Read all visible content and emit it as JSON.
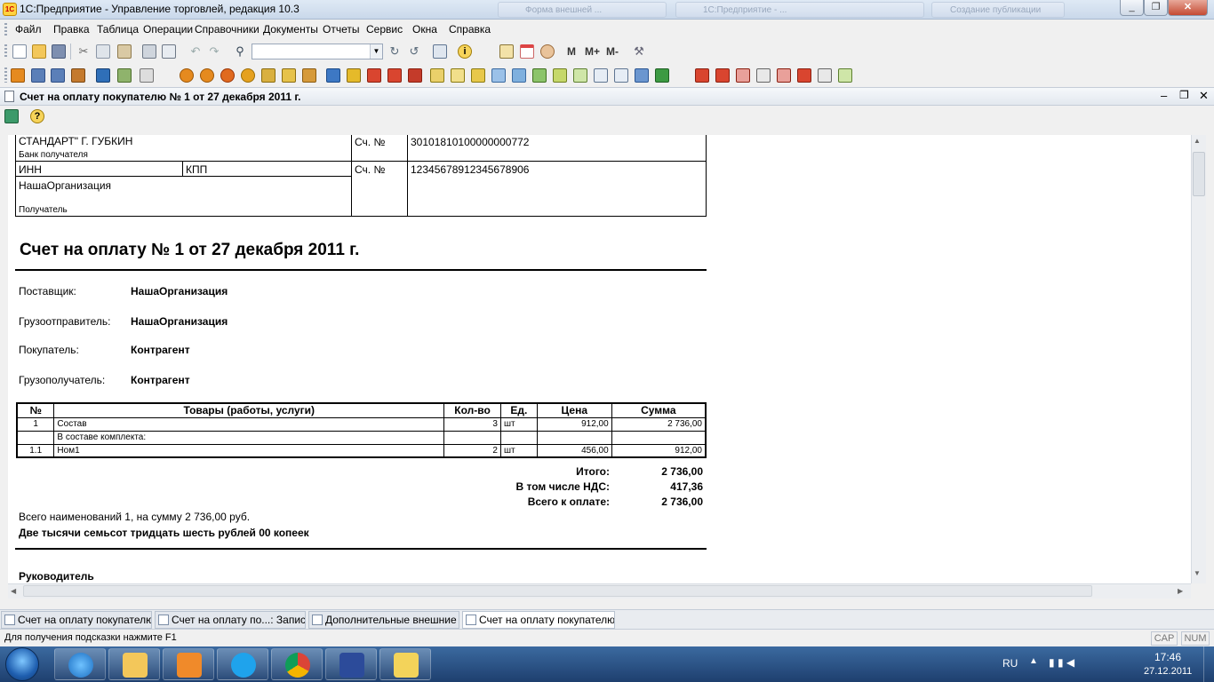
{
  "window": {
    "title": "1С:Предприятие - Управление торговлей, редакция 10.3",
    "bg_tabs": [
      "Форма внешней ...",
      "1С:Предприятие - ...",
      "Создание публикации"
    ]
  },
  "menu": [
    "Файл",
    "Правка",
    "Таблица",
    "Операции",
    "Справочники",
    "Документы",
    "Отчеты",
    "Сервис",
    "Окна",
    "Справка"
  ],
  "toolbar": {
    "search_value": "",
    "m_buttons": [
      "M",
      "M+",
      "M-"
    ]
  },
  "document": {
    "title": "Счет на оплату покупателю № 1 от 27 декабря 2011 г.",
    "bank": {
      "name": "СТАНДАРТ\" Г. ГУБКИН",
      "bank_label": "Банк получателя",
      "account_label": "Сч. №",
      "bank_account": "30101810100000000772",
      "inn_label": "ИНН",
      "kpp_label": "КПП",
      "account_label2": "Сч. №",
      "recipient_account": "12345678912345678906",
      "recipient_name": "НашаОрганизация",
      "recipient_label": "Получатель"
    },
    "heading": "Счет на оплату № 1 от 27 декабря 2011 г.",
    "parties": [
      {
        "label": "Поставщик:",
        "value": "НашаОрганизация"
      },
      {
        "label": "Грузоотправитель:",
        "value": "НашаОрганизация"
      },
      {
        "label": "Покупатель:",
        "value": "Контрагент"
      },
      {
        "label": "Грузополучатель:",
        "value": "Контрагент"
      }
    ],
    "table": {
      "headers": [
        "№",
        "Товары (работы, услуги)",
        "Кол-во",
        "Ед.",
        "Цена",
        "Сумма"
      ],
      "rows": [
        {
          "n": "1",
          "name": "Состав",
          "qty": "3",
          "unit": "шт",
          "price": "912,00",
          "sum": "2 736,00"
        },
        {
          "n": "",
          "name": "В составе комплекта:",
          "qty": "",
          "unit": "",
          "price": "",
          "sum": ""
        },
        {
          "n": "1.1",
          "name": "Ном1",
          "qty": "2",
          "unit": "шт",
          "price": "456,00",
          "sum": "912,00"
        }
      ]
    },
    "totals": [
      {
        "label": "Итого:",
        "value": "2 736,00"
      },
      {
        "label": "В том числе НДС:",
        "value": "417,36"
      },
      {
        "label": "Всего к оплате:",
        "value": "2 736,00"
      }
    ],
    "summary_line": "Всего наименований 1, на сумму 2 736,00 руб.",
    "amount_words": "Две тысячи семьсот тридцать шесть рублей 00 копеек",
    "signature_label": "Руководитель"
  },
  "tabs": [
    "Счет на оплату покупателю",
    "Счет на оплату по...: Записан",
    "Дополнительные внешние ...",
    "Счет на оплату покупателю ..."
  ],
  "status": {
    "hint": "Для получения подсказки нажмите F1",
    "cap": "CAP",
    "num": "NUM"
  },
  "taskbar": {
    "lang": "RU",
    "time": "17:46",
    "date": "27.12.2011"
  },
  "colors": {
    "accent": "#1e3f6e",
    "toolbar_icon_orange": "#e58a1f",
    "toolbar_icon_blue": "#2f6fb8"
  }
}
